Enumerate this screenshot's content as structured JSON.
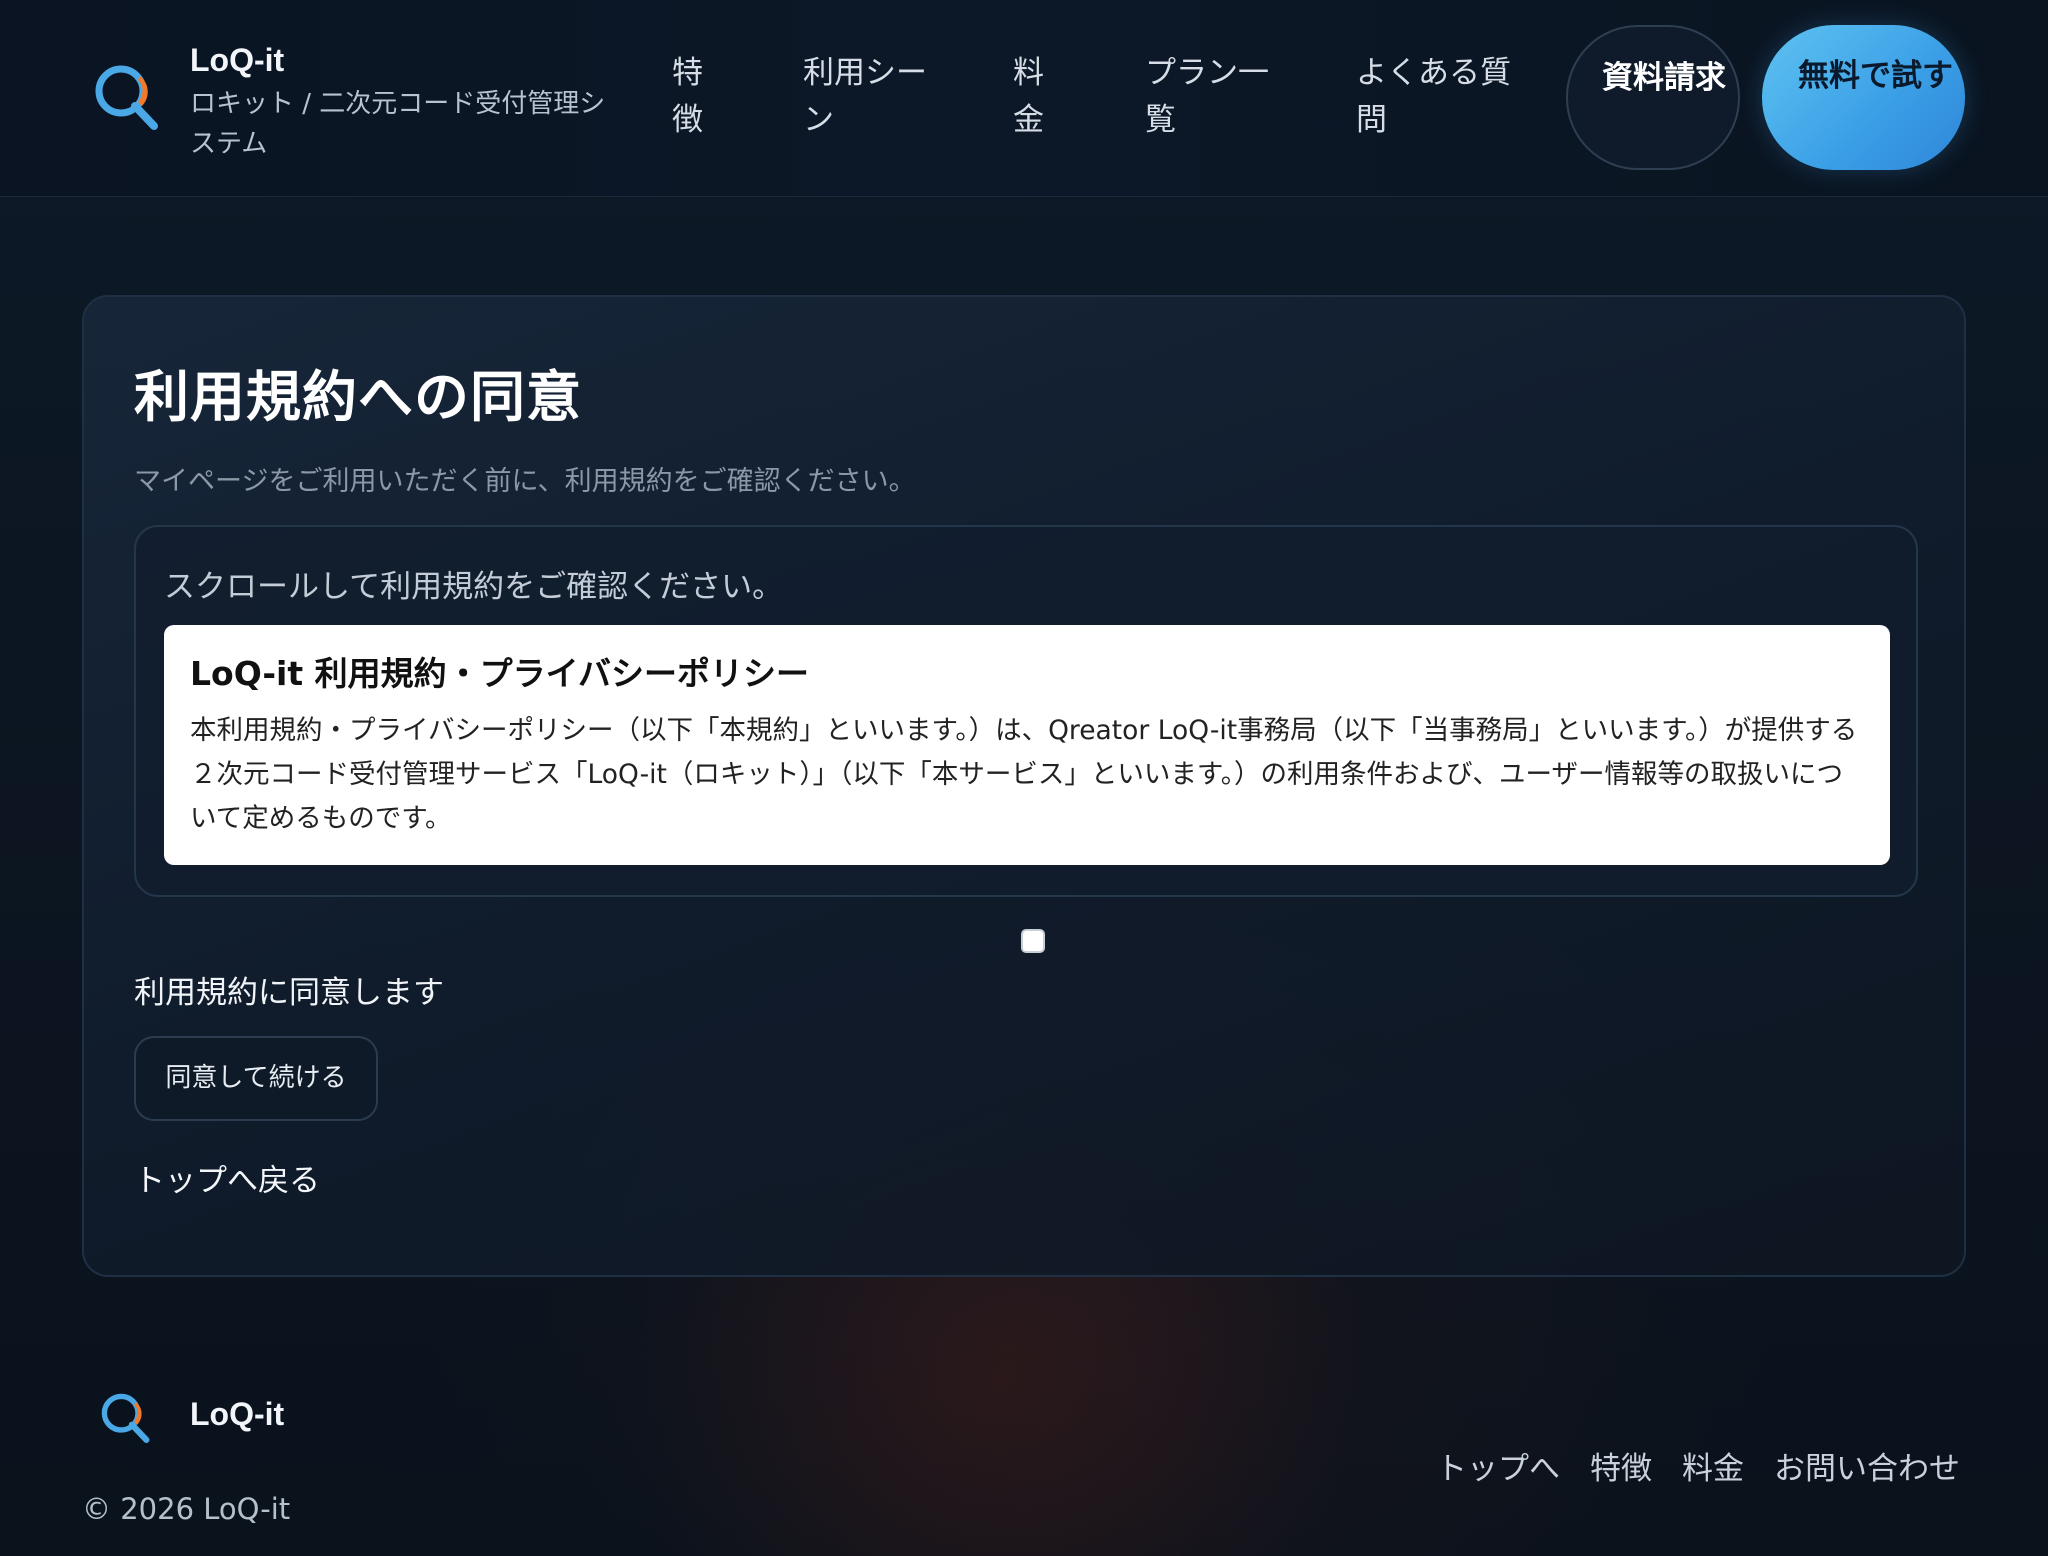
{
  "header": {
    "brand_name": "LoQ-it",
    "brand_sub": "ロキット / 二次元コード受付管理システム",
    "nav": [
      {
        "label": "特徴"
      },
      {
        "label": "利用シーン"
      },
      {
        "label": "料金"
      },
      {
        "label": "プラン一覧"
      },
      {
        "label": "よくある質問"
      }
    ],
    "cta_doc": "資料請求",
    "cta_trial": "無料で試す"
  },
  "main": {
    "title": "利用規約への同意",
    "lead": "マイページをご利用いただく前に、利用規約をご確認ください。",
    "terms_hint": "スクロールして利用規約をご確認ください。",
    "terms_heading": "LoQ-it 利用規約・プライバシーポリシー",
    "terms_body": "本利用規約・プライバシーポリシー（以下「本規約」といいます。）は、Qreator LoQ-it事務局（以下「当事務局」といいます。）が提供する２次元コード受付管理サービス「LoQ-it（ロキット）」（以下「本サービス」といいます。）の利用条件および、ユーザー情報等の取扱いについて定めるものです。",
    "agree_label": "利用規約に同意します",
    "agree_checked": false,
    "continue_label": "同意して続ける",
    "back_label": "トップへ戻る"
  },
  "footer": {
    "brand_name": "LoQ-it",
    "copyright": "© 2026 LoQ-it",
    "links": [
      {
        "label": "トップへ"
      },
      {
        "label": "特徴"
      },
      {
        "label": "料金"
      },
      {
        "label": "お問い合わせ"
      }
    ]
  },
  "colors": {
    "accent_blue": "#3a9ee6",
    "logo_orange": "#f07a2a",
    "background": "#0c1622"
  },
  "icons": {
    "brand": "magnifier-q-logo-icon"
  }
}
